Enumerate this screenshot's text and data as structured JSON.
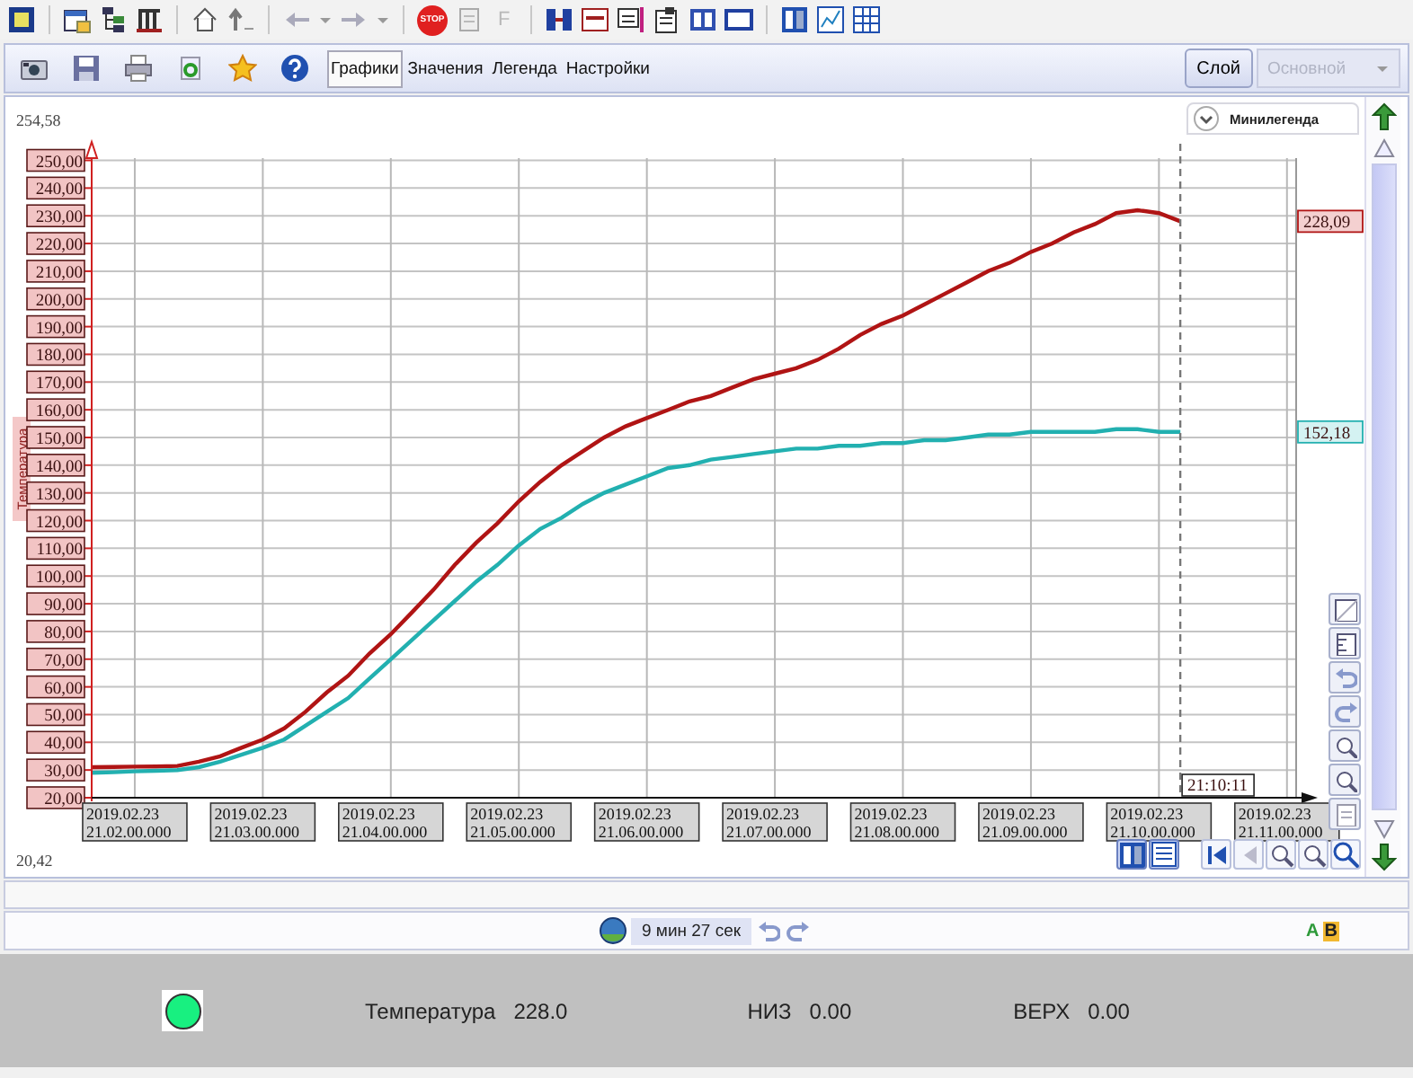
{
  "main_toolbar": {
    "stop_button": {
      "label": "STOP"
    },
    "font_button": {
      "label": "F",
      "disabled": true
    }
  },
  "chart_toolbar": {
    "tabs": [
      {
        "label": "Графики",
        "selected": true
      },
      {
        "label": "Значения",
        "selected": false
      },
      {
        "label": "Легенда",
        "selected": false
      },
      {
        "label": "Настройки",
        "selected": false
      }
    ],
    "layer_button": "Слой",
    "layer_select": {
      "value": "Основной",
      "disabled": true
    }
  },
  "chart": {
    "range_max": "254,58",
    "range_min": "20,42",
    "minilegend_button": "Минилегенда",
    "chart_data": {
      "type": "line",
      "ylabel": "Температура",
      "categories": [
        null,
        null,
        "2019.02.23\n21.02.00.000",
        null,
        null,
        null,
        null,
        null,
        "2019.02.23\n21.03.00.000",
        null,
        null,
        null,
        null,
        null,
        "2019.02.23\n21.04.00.000",
        null,
        null,
        null,
        null,
        null,
        "2019.02.23\n21.05.00.000",
        null,
        null,
        null,
        null,
        null,
        "2019.02.23\n21.06.00.000",
        null,
        null,
        null,
        null,
        null,
        "2019.02.23\n21.07.00.000",
        null,
        null,
        null,
        null,
        null,
        "2019.02.23\n21.08.00.000",
        null,
        null,
        null,
        null,
        null,
        "2019.02.23\n21.09.00.000",
        null,
        null,
        null,
        null,
        null,
        "2019.02.23\n21.10.00.000",
        null,
        null,
        null,
        null,
        null,
        "2019.02.23\n21.11.00.000"
      ],
      "series": [
        {
          "color": "#b01414",
          "values": [
            31,
            31.1,
            31.2,
            31.3,
            31.5,
            33,
            35,
            38,
            41,
            45,
            51,
            58,
            64,
            72,
            79,
            87,
            95,
            104,
            112,
            119,
            127,
            134,
            140,
            145,
            150,
            154,
            157,
            160,
            163,
            165,
            168,
            171,
            173,
            175,
            178,
            182,
            187,
            191,
            194,
            198,
            202,
            206,
            210,
            213,
            217,
            220,
            224,
            227,
            231,
            232,
            231,
            228,
            null,
            null,
            null,
            null,
            null
          ]
        },
        {
          "color": "#22b0b0",
          "values": [
            29,
            29.2,
            29.5,
            29.7,
            30,
            31,
            33,
            35.5,
            38,
            41,
            46,
            51,
            56,
            63,
            70,
            77,
            84,
            91,
            98,
            104,
            111,
            117,
            121,
            126,
            130,
            133,
            136,
            139,
            140,
            142,
            143,
            144,
            145,
            146,
            146,
            147,
            147,
            148,
            148,
            149,
            149,
            150,
            151,
            151,
            152,
            152,
            152,
            152,
            153,
            153,
            152,
            152,
            null,
            null,
            null,
            null,
            null
          ]
        }
      ],
      "ylim": [
        20,
        256
      ],
      "grid": true,
      "yticks": [
        {
          "value": 20,
          "label": "20,00"
        },
        {
          "value": 30,
          "label": "30,00"
        },
        {
          "value": 40,
          "label": "40,00"
        },
        {
          "value": 50,
          "label": "50,00"
        },
        {
          "value": 60,
          "label": "60,00"
        },
        {
          "value": 70,
          "label": "70,00"
        },
        {
          "value": 80,
          "label": "80,00"
        },
        {
          "value": 90,
          "label": "90,00"
        },
        {
          "value": 100,
          "label": "100,00"
        },
        {
          "value": 110,
          "label": "110,00"
        },
        {
          "value": 120,
          "label": "120,00"
        },
        {
          "value": 130,
          "label": "130,00"
        },
        {
          "value": 140,
          "label": "140,00"
        },
        {
          "value": 150,
          "label": "150,00"
        },
        {
          "value": 160,
          "label": "160,00"
        },
        {
          "value": 170,
          "label": "170,00"
        },
        {
          "value": 180,
          "label": "180,00"
        },
        {
          "value": 190,
          "label": "190,00"
        },
        {
          "value": 200,
          "label": "200,00"
        },
        {
          "value": 210,
          "label": "210,00"
        },
        {
          "value": 220,
          "label": "220,00"
        },
        {
          "value": 230,
          "label": "230,00"
        },
        {
          "value": 240,
          "label": "240,00"
        },
        {
          "value": 250,
          "label": "250,00"
        }
      ]
    },
    "cursor_time": "21:10:11",
    "value_tags": [
      "228,09",
      "152,18"
    ]
  },
  "status_bar": {
    "elapsed": "9 мин 27 сек",
    "markers": [
      {
        "kind": "letter",
        "label": "A",
        "color": "#2e9a3a"
      },
      {
        "kind": "badge",
        "label": "B",
        "color": "#f2b830"
      }
    ]
  },
  "indicators": {
    "lamp": {
      "on": true
    },
    "readings": [
      {
        "label": "Температура",
        "value": "228.0"
      },
      {
        "label": "НИЗ",
        "value": "0.00"
      },
      {
        "label": "ВЕРХ",
        "value": "0.00"
      }
    ]
  }
}
